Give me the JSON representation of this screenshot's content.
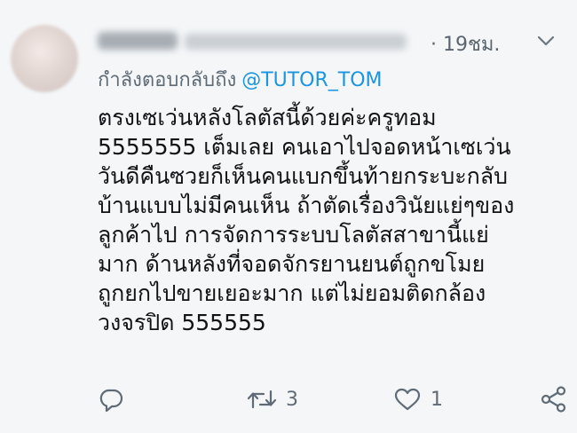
{
  "tweet": {
    "time": "· 19ชม.",
    "reply_prefix": "กำลังตอบกลับถึง",
    "reply_mention": "@TUTOR_TOM",
    "lines": [
      "ตรงเซเว่นหลังโลตัสนี้ด้วยค่ะครูทอม",
      "5555555 เต็มเลย คนเอาไปจอดหน้าเซเว่น",
      "วันดีคืนซวยก็เห็นคนแบกขึ้นท้ายกระบะกลับ",
      "บ้านแบบไม่มีคนเห็น ถ้าตัดเรื่องวินัยแย่ๆของ",
      "ลูกค้าไป การจัดการระบบโลตัสสาขานี้แย่",
      "มาก ด้านหลังที่จอดจักรยานยนต์ถูกขโมย",
      "ถูกยกไปขายเยอะมาก แต่ไม่ยอมติดกล้อง",
      "วงจรปิด 555555"
    ],
    "retweet_count": "3",
    "like_count": "1"
  },
  "icons": {
    "reply": "comment-bubble-icon",
    "retweet": "retweet-arrows-icon",
    "like": "heart-icon",
    "share": "share-icon",
    "menu": "chevron-down-icon"
  },
  "colors": {
    "accent": "#1b95e0",
    "muted": "#5f6b76",
    "text": "#111417"
  }
}
